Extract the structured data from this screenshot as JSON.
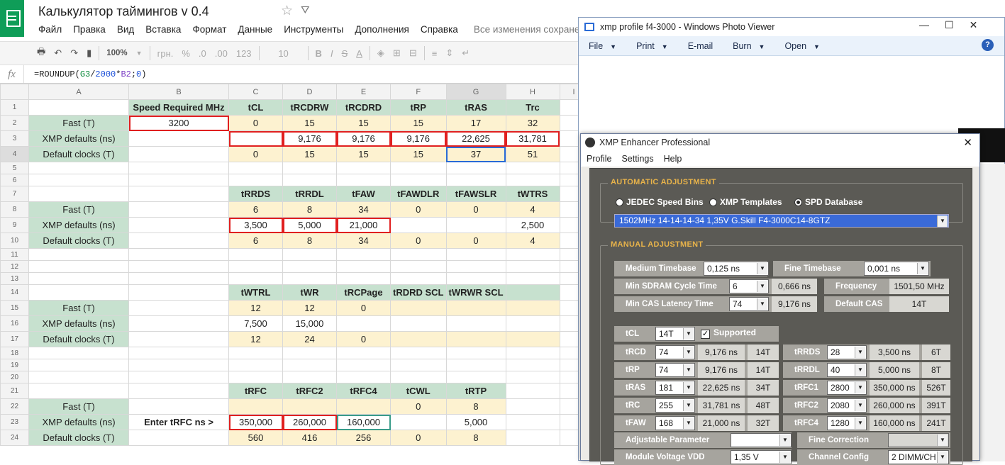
{
  "sheets": {
    "title": "Калькулятор таймингов v 0.4",
    "menu": [
      "Файл",
      "Правка",
      "Вид",
      "Вставка",
      "Формат",
      "Данные",
      "Инструменты",
      "Дополнения",
      "Справка"
    ],
    "saved": "Все изменения сохранены",
    "toolbar": {
      "zoom": "100%",
      "currency": "грн.",
      "percent": "%",
      "dec0": ".0",
      "dec00": ".00",
      "numfmt": "123",
      "fontsize": "10"
    },
    "formula_parts": [
      "=ROUNDUP(",
      "G3",
      "/",
      "2000",
      "*",
      "B2",
      ";",
      "0",
      ")"
    ],
    "fx": "fx",
    "col_headers": [
      "A",
      "B",
      "C",
      "D",
      "E",
      "F",
      "G",
      "H",
      "I"
    ],
    "rows": {
      "r1": [
        "",
        "Speed Required MHz",
        "tCL",
        "tRCDRW",
        "tRCDRD",
        "tRP",
        "tRAS",
        "Trc"
      ],
      "r2": [
        "Fast (T)",
        "3200",
        "0",
        "15",
        "15",
        "15",
        "17",
        "32"
      ],
      "r3": [
        "XMP defaults (ns)",
        "",
        "",
        "9,176",
        "9,176",
        "9,176",
        "22,625",
        "31,781"
      ],
      "r4": [
        "Default clocks (T)",
        "",
        "0",
        "15",
        "15",
        "15",
        "37",
        "51"
      ],
      "r7": [
        "",
        "",
        "tRRDS",
        "tRRDL",
        "tFAW",
        "tFAWDLR",
        "tFAWSLR",
        "tWTRS"
      ],
      "r8": [
        "Fast (T)",
        "",
        "6",
        "8",
        "34",
        "0",
        "0",
        "4"
      ],
      "r9": [
        "XMP defaults (ns)",
        "",
        "3,500",
        "5,000",
        "21,000",
        "",
        "",
        "2,500"
      ],
      "r10": [
        "Default clocks (T)",
        "",
        "6",
        "8",
        "34",
        "0",
        "0",
        "4"
      ],
      "r14": [
        "",
        "",
        "tWTRL",
        "tWR",
        "tRCPage",
        "tRDRD SCL",
        "tWRWR SCL",
        ""
      ],
      "r15": [
        "Fast (T)",
        "",
        "12",
        "12",
        "0",
        "",
        "",
        ""
      ],
      "r16": [
        "XMP defaults (ns)",
        "",
        "7,500",
        "15,000",
        "",
        "",
        "",
        ""
      ],
      "r17": [
        "Default clocks (T)",
        "",
        "12",
        "24",
        "0",
        "",
        "",
        ""
      ],
      "r21": [
        "",
        "",
        "tRFC",
        "tRFC2",
        "tRFC4",
        "tCWL",
        "tRTP",
        ""
      ],
      "r22": [
        "Fast (T)",
        "",
        "",
        "",
        "",
        "0",
        "8",
        ""
      ],
      "r23": [
        "XMP defaults (ns)",
        "Enter tRFC ns >",
        "350,000",
        "260,000",
        "160,000",
        "",
        "5,000",
        ""
      ],
      "r24": [
        "Default clocks (T)",
        "",
        "560",
        "416",
        "256",
        "0",
        "8",
        ""
      ]
    }
  },
  "photoviewer": {
    "title": "xmp profile f4-3000 - Windows Photo Viewer",
    "menu": [
      "File",
      "Print",
      "E-mail",
      "Burn",
      "Open"
    ],
    "help": "?"
  },
  "xmp": {
    "title": "XMP Enhancer Professional",
    "menu": [
      "Profile",
      "Settings",
      "Help"
    ],
    "auto_title": "AUTOMATIC ADJUSTMENT",
    "radios": [
      "JEDEC Speed Bins",
      "XMP Templates",
      "SPD Database"
    ],
    "profile_select": "1502MHz 14-14-14-34 1,35V  G.Skill F4-3000C14-8GTZ",
    "manual_title": "MANUAL ADJUSTMENT",
    "medium_timebase_label": "Medium Timebase",
    "medium_timebase": "0,125 ns",
    "fine_timebase_label": "Fine Timebase",
    "fine_timebase": "0,001 ns",
    "min_cycle_label": "Min SDRAM Cycle Time",
    "min_cycle": "6",
    "min_cycle_ns": "0,666 ns",
    "frequency_label": "Frequency",
    "frequency": "1501,50 MHz",
    "min_cas_label": "Min CAS Latency Time",
    "min_cas": "74",
    "min_cas_ns": "9,176 ns",
    "default_cas_label": "Default CAS",
    "default_cas": "14T",
    "tcl_label": "tCL",
    "tcl": "14T",
    "supported": "Supported",
    "left_timings": [
      {
        "name": "tRCD",
        "val": "74",
        "ns": "9,176 ns",
        "t": "14T"
      },
      {
        "name": "tRP",
        "val": "74",
        "ns": "9,176 ns",
        "t": "14T"
      },
      {
        "name": "tRAS",
        "val": "181",
        "ns": "22,625 ns",
        "t": "34T"
      },
      {
        "name": "tRC",
        "val": "255",
        "ns": "31,781 ns",
        "t": "48T"
      },
      {
        "name": "tFAW",
        "val": "168",
        "ns": "21,000 ns",
        "t": "32T"
      }
    ],
    "right_timings": [
      {
        "name": "tRRDS",
        "val": "28",
        "ns": "3,500 ns",
        "t": "6T"
      },
      {
        "name": "tRRDL",
        "val": "40",
        "ns": "5,000 ns",
        "t": "8T"
      },
      {
        "name": "tRFC1",
        "val": "2800",
        "ns": "350,000 ns",
        "t": "526T"
      },
      {
        "name": "tRFC2",
        "val": "2080",
        "ns": "260,000 ns",
        "t": "391T"
      },
      {
        "name": "tRFC4",
        "val": "1280",
        "ns": "160,000 ns",
        "t": "241T"
      }
    ],
    "adjustable_label": "Adjustable Parameter",
    "fine_correction_label": "Fine Correction",
    "module_voltage_label": "Module Voltage VDD",
    "module_voltage": "1,35 V",
    "channel_label": "Channel Config",
    "channel": "2 DIMM/CH"
  }
}
